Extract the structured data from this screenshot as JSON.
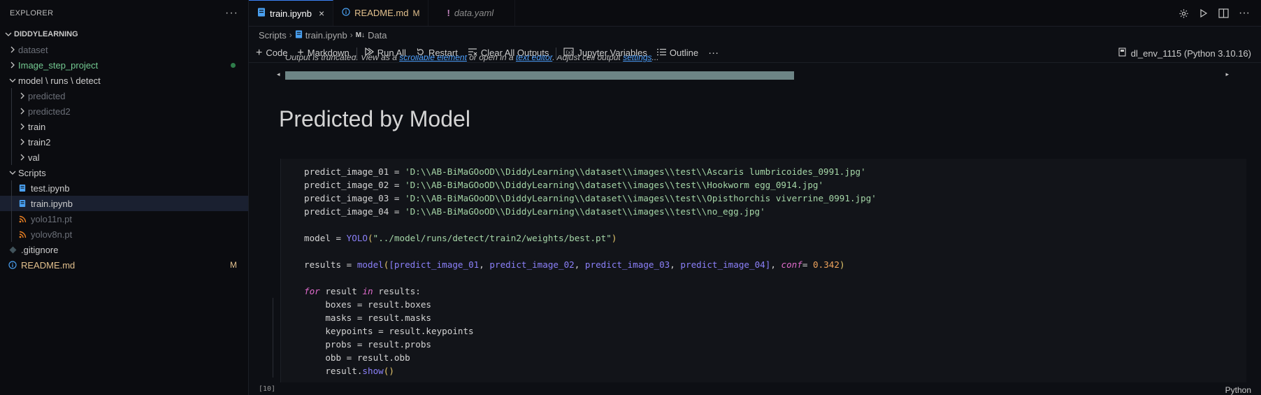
{
  "sidebar": {
    "title": "EXPLORER",
    "more": "···",
    "root": "DIDDYLEARNING",
    "items": [
      {
        "label": "dataset",
        "type": "folder",
        "depth": 0,
        "style": "dim"
      },
      {
        "label": "Image_step_project",
        "type": "folder",
        "depth": 0,
        "style": "green",
        "dot": true
      },
      {
        "label": "model \\ runs \\ detect",
        "type": "folder-open",
        "depth": 0,
        "style": "normal"
      },
      {
        "label": "predicted",
        "type": "folder",
        "depth": 1,
        "style": "dim"
      },
      {
        "label": "predicted2",
        "type": "folder",
        "depth": 1,
        "style": "dim"
      },
      {
        "label": "train",
        "type": "folder",
        "depth": 1,
        "style": "normal"
      },
      {
        "label": "train2",
        "type": "folder",
        "depth": 1,
        "style": "normal"
      },
      {
        "label": "val",
        "type": "folder",
        "depth": 1,
        "style": "normal"
      },
      {
        "label": "Scripts",
        "type": "folder-open",
        "depth": 0,
        "style": "normal"
      },
      {
        "label": "test.ipynb",
        "type": "notebook",
        "depth": 1,
        "style": "normal"
      },
      {
        "label": "train.ipynb",
        "type": "notebook",
        "depth": 1,
        "style": "normal",
        "active": true
      },
      {
        "label": "yolo11n.pt",
        "type": "rss",
        "depth": 1,
        "style": "dim"
      },
      {
        "label": "yolov8n.pt",
        "type": "rss",
        "depth": 1,
        "style": "dim"
      },
      {
        "label": ".gitignore",
        "type": "git",
        "depth": 0,
        "style": "normal"
      },
      {
        "label": "README.md",
        "type": "info",
        "depth": 0,
        "style": "orange",
        "badge": "M"
      }
    ]
  },
  "tabs": [
    {
      "label": "train.ipynb",
      "active": true,
      "close": "×"
    },
    {
      "label": "README.md",
      "badge": "M"
    },
    {
      "label": "data.yaml",
      "italic": true
    }
  ],
  "breadcrumb": [
    "Scripts",
    "train.ipynb",
    "Data"
  ],
  "toolbar": {
    "code": "Code",
    "markdown": "Markdown",
    "run_all": "Run All",
    "restart": "Restart",
    "clear": "Clear All Outputs",
    "variables": "Jupyter Variables",
    "outline": "Outline",
    "more": "···",
    "kernel": "dl_env_1115 (Python 3.10.16)"
  },
  "output": {
    "truncated_prefix": "Output is truncated. View as a ",
    "link1": "scrollable element",
    "mid": " or open in a ",
    "link2": "text editor",
    "suffix": ". Adjust cell output ",
    "link3": "settings",
    "ellipsis": "...",
    "scroll_position": 0.53
  },
  "markdown_heading": "Predicted by Model",
  "cell": {
    "exec_count": "[10]",
    "language": "Python",
    "code": {
      "v1": "predict_image_01",
      "s1": "'D:\\\\AB-BiMaGOoOD\\\\DiddyLearning\\\\dataset\\\\images\\\\test\\\\Ascaris lumbricoides_0991.jpg'",
      "v2": "predict_image_02",
      "s2": "'D:\\\\AB-BiMaGOoOD\\\\DiddyLearning\\\\dataset\\\\images\\\\test\\\\Hookworm egg_0914.jpg'",
      "v3": "predict_image_03",
      "s3": "'D:\\\\AB-BiMaGOoOD\\\\DiddyLearning\\\\dataset\\\\images\\\\test\\\\Opisthorchis viverrine_0991.jpg'",
      "v4": "predict_image_04",
      "s4": "'D:\\\\AB-BiMaGOoOD\\\\DiddyLearning\\\\dataset\\\\images\\\\test\\\\no_egg.jpg'",
      "model_var": "model",
      "yolo_fn": "YOLO",
      "yolo_arg": "\"../model/runs/detect/train2/weights/best.pt\"",
      "results_var": "results",
      "model_call": "model",
      "conf_kw": "conf",
      "conf_val": "0.342",
      "for_kw": "for",
      "in_kw": "in",
      "loop_var": "result",
      "iter_var": "results",
      "l1": "boxes = result.boxes",
      "l2": "masks = result.masks",
      "l3": "keypoints = result.keypoints",
      "l4": "probs = result.probs",
      "l5": "obb = result.obb",
      "show_obj": "result.",
      "show_fn": "show"
    }
  }
}
